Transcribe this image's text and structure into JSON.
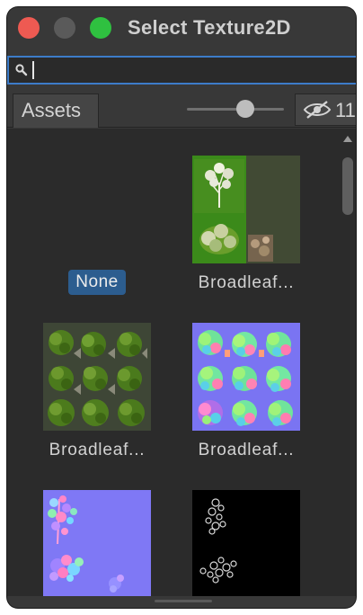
{
  "window": {
    "title": "Select Texture2D"
  },
  "search": {
    "value": "",
    "placeholder": ""
  },
  "toolbar": {
    "tab_label": "Assets",
    "thumbnail_size": 0.6,
    "hidden_count": "11"
  },
  "items": [
    {
      "label": "None",
      "selected": true,
      "icon": "none"
    },
    {
      "label": "Broadleaf...",
      "selected": false,
      "icon": "broadleaf-color-texture"
    },
    {
      "label": "Broadleaf...",
      "selected": false,
      "icon": "broadleaf-leaves-texture"
    },
    {
      "label": "Broadleaf...",
      "selected": false,
      "icon": "broadleaf-normal-map"
    },
    {
      "label": "",
      "selected": false,
      "icon": "broadleaf-normal-map-2"
    },
    {
      "label": "",
      "selected": false,
      "icon": "broadleaf-mask-texture"
    }
  ],
  "colors": {
    "accent": "#3d7cc9",
    "selection": "#2c5d8f",
    "close": "#ee5a52",
    "minimize": "#5a5a5a",
    "zoom": "#2fc140"
  }
}
